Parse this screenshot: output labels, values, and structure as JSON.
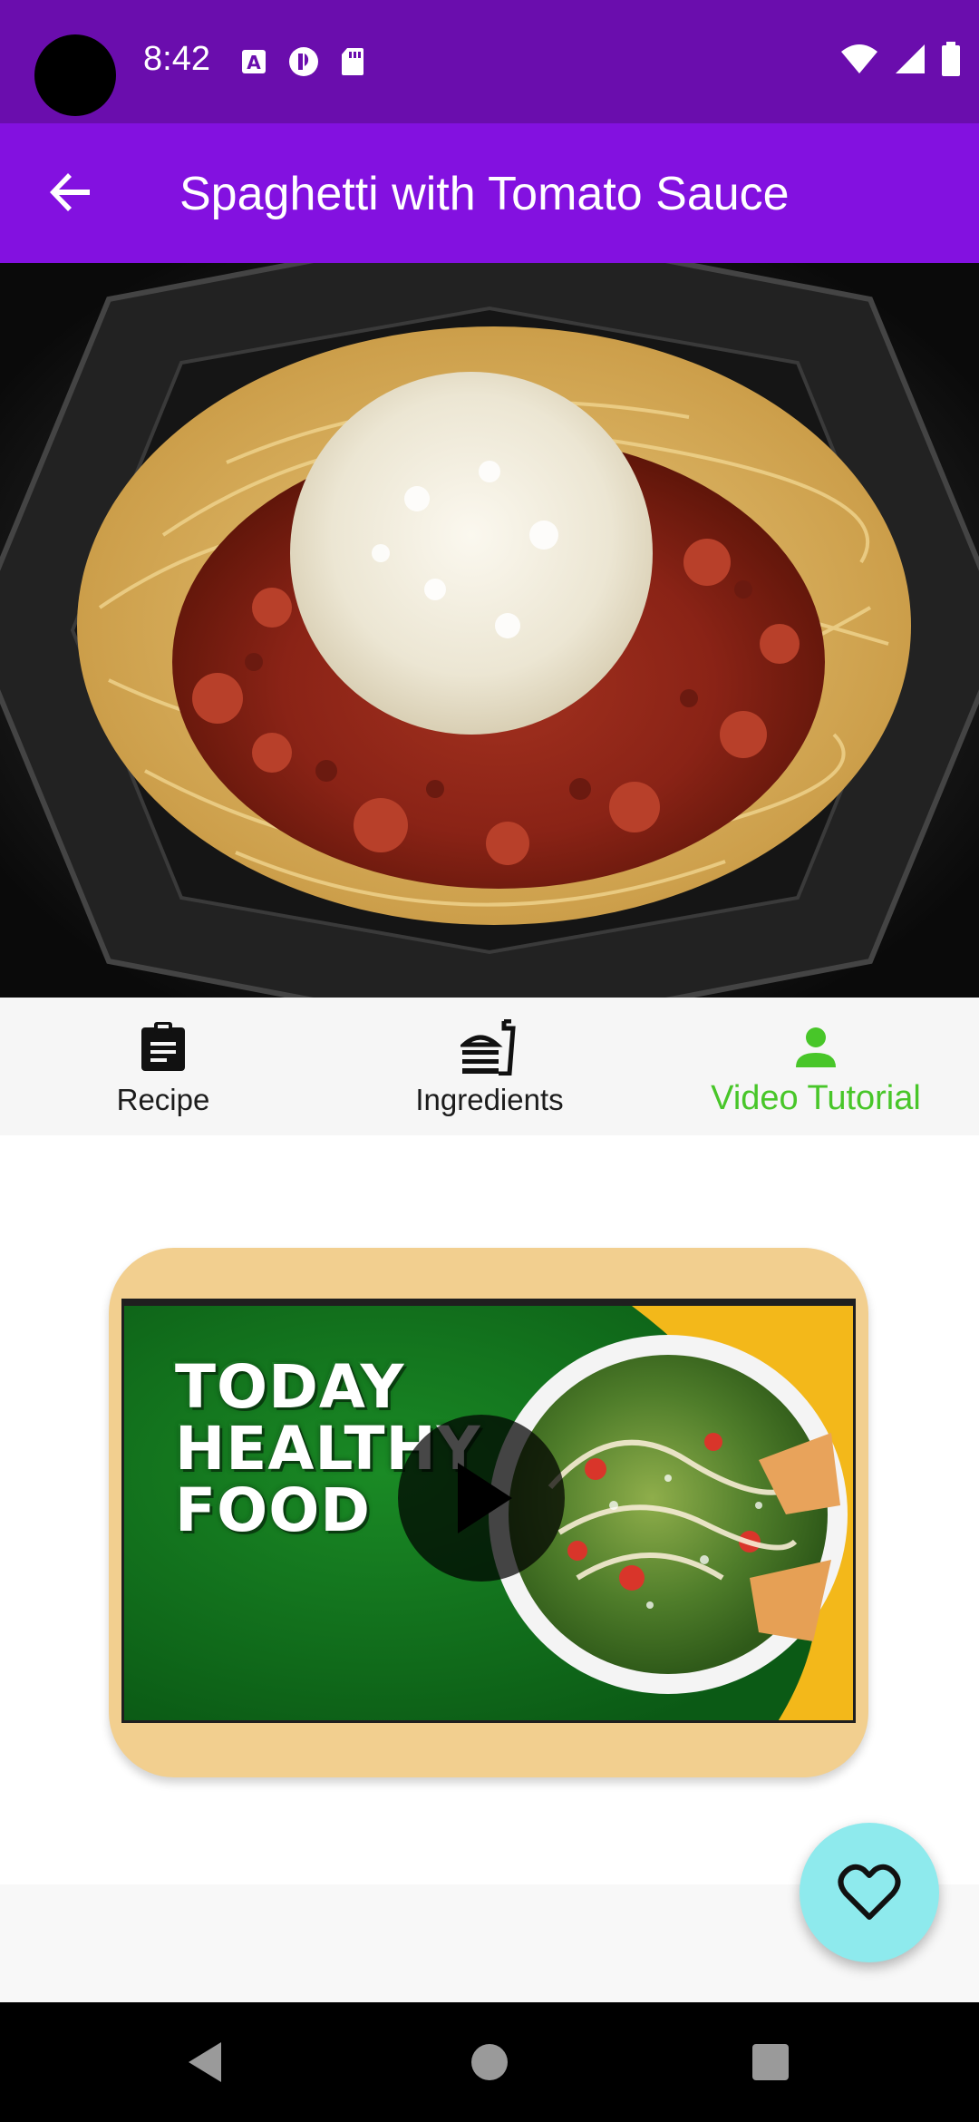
{
  "status_bar": {
    "time": "8:42",
    "left_icons": [
      "text-a-icon",
      "data-saver-icon",
      "sd-card-icon"
    ],
    "right_icons": [
      "wifi-icon",
      "signal-icon",
      "battery-icon"
    ]
  },
  "app_bar": {
    "title": "Spaghetti with Tomato Sauce",
    "back_icon": "arrow-back-icon"
  },
  "hero": {
    "subject": "spaghetti-bolognese-photo"
  },
  "tabs": [
    {
      "label": "Recipe",
      "icon": "clipboard-icon",
      "active": false
    },
    {
      "label": "Ingredients",
      "icon": "fastfood-icon",
      "active": false
    },
    {
      "label": "Video Tutorial",
      "icon": "person-icon",
      "active": true
    }
  ],
  "video": {
    "thumbnail_text": [
      "TODAY",
      "HEALTHY",
      "FOOD"
    ],
    "play_icon": "play-icon"
  },
  "fab": {
    "icon": "heart-outline-icon"
  },
  "nav_bar": {
    "icons": [
      "back-triangle-icon",
      "home-circle-icon",
      "recents-square-icon"
    ]
  },
  "colors": {
    "status_bar": "#6a0dad",
    "app_bar": "#8311e0",
    "active_tab": "#48c629",
    "card": "#f2cf8f",
    "fab": "#8eeaed"
  }
}
